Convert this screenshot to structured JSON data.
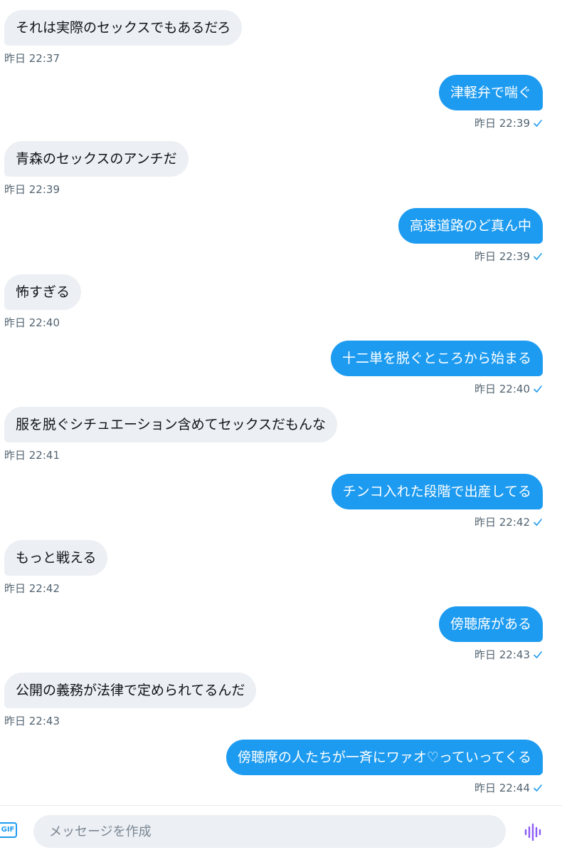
{
  "colors": {
    "accent": "#1d9bf0",
    "received_bubble": "#eceff3",
    "meta_text": "#536471",
    "voice_icon": "#8b5cf6"
  },
  "messages": [
    {
      "side": "received",
      "text": "それは実際のセックスでもあるだろ",
      "time": "昨日 22:37"
    },
    {
      "side": "sent",
      "text": "津軽弁で喘ぐ",
      "time": "昨日 22:39"
    },
    {
      "side": "received",
      "text": "青森のセックスのアンチだ",
      "time": "昨日 22:39"
    },
    {
      "side": "sent",
      "text": "高速道路のど真ん中",
      "time": "昨日 22:39"
    },
    {
      "side": "received",
      "text": "怖すぎる",
      "time": "昨日 22:40"
    },
    {
      "side": "sent",
      "text": "十二単を脱ぐところから始まる",
      "time": "昨日 22:40"
    },
    {
      "side": "received",
      "text": "服を脱ぐシチュエーション含めてセックスだもんな",
      "time": "昨日 22:41"
    },
    {
      "side": "sent",
      "text": "チンコ入れた段階で出産してる",
      "time": "昨日 22:42"
    },
    {
      "side": "received",
      "text": "もっと戦える",
      "time": "昨日 22:42"
    },
    {
      "side": "sent",
      "text": "傍聴席がある",
      "time": "昨日 22:43"
    },
    {
      "side": "received",
      "text": "公開の義務が法律で定められてるんだ",
      "time": "昨日 22:43"
    },
    {
      "side": "sent",
      "text": "傍聴席の人たちが一斉にワァオ♡っていってくる",
      "time": "昨日 22:44"
    }
  ],
  "composer": {
    "gif_label": "GIF",
    "placeholder": "メッセージを作成",
    "voice_icon": "audio-waveform-icon"
  }
}
